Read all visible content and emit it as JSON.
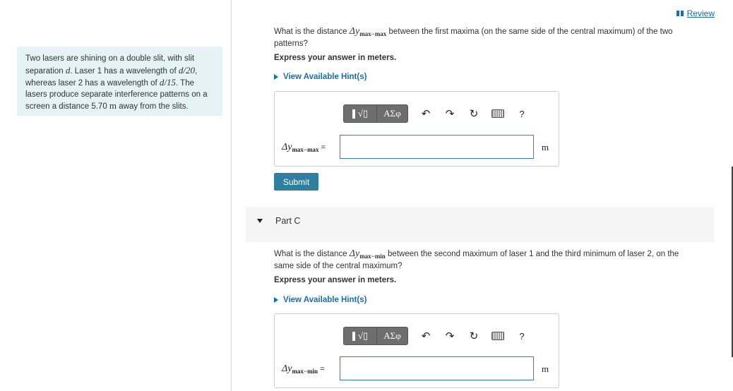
{
  "review": {
    "label": "Review"
  },
  "problem": {
    "t1": "Two lasers are shining on a double slit, with slit separation ",
    "d": "d",
    "t2": ". Laser 1 has a wavelength of ",
    "w1": "d/20",
    "t3": ", whereas laser 2 has a wavelength of ",
    "w2": "d/15",
    "t4": ". The lasers produce separate interference patterns on a screen a distance 5.70 ",
    "unit": "m",
    "t5": " away from the slits."
  },
  "part_b": {
    "question_pre": "What is the distance ",
    "symbol": "Δy",
    "symbol_sub": "max−max",
    "question_post": " between the first maxima (on the same side of the central maximum) of the two patterns?",
    "express": "Express your answer in meters.",
    "hint": "View Available Hint(s)",
    "eq_symbol": "Δy",
    "eq_sub": "max−max",
    "eq_sign": "=",
    "input_value": "",
    "unit": "m",
    "submit": "Submit"
  },
  "toolbar": {
    "frac_glyph": "√▯",
    "greek": "ΑΣφ",
    "undo": "↶",
    "redo": "↷",
    "reset": "↻",
    "help": "?"
  },
  "part_c": {
    "title": "Part C",
    "question_pre": "What is the distance ",
    "symbol": "Δy",
    "symbol_sub": "max−min",
    "question_post": " between the second maximum of laser 1 and the third minimum of laser 2, on the same side of the central maximum?",
    "express": "Express your answer in meters.",
    "hint": "View Available Hint(s)",
    "eq_symbol": "Δy",
    "eq_sub": "max−min",
    "eq_sign": "=",
    "input_value": "",
    "unit": "m"
  }
}
